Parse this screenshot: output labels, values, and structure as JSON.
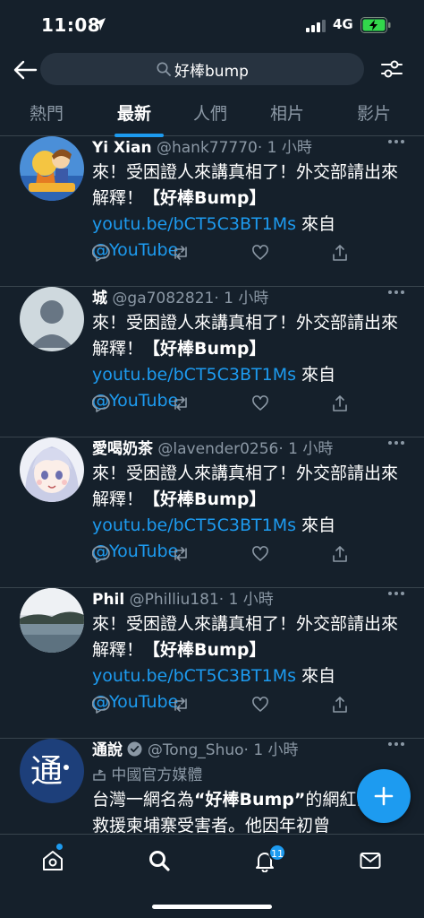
{
  "status_bar": {
    "time": "11:08",
    "network": "4G",
    "colors": {
      "battery": "#32d74b"
    }
  },
  "search": {
    "query": "好棒bump"
  },
  "tabs": [
    {
      "label": "熱門"
    },
    {
      "label": "最新",
      "active": true
    },
    {
      "label": "人們"
    },
    {
      "label": "相片"
    },
    {
      "label": "影片"
    }
  ],
  "tweets": [
    {
      "name": "Yi Xian",
      "handle": "@hank77770",
      "time": "· 1 小時",
      "text_a": "來！受困證人來講真相了！外交部請出來解釋！",
      "text_bold": "【好棒Bump】",
      "link": "youtu.be/bCT5C3BT1Ms",
      "via": " 來自 ",
      "mention": "@YouTube"
    },
    {
      "name": "城",
      "handle": "@ga7082821",
      "time": "· 1 小時",
      "text_a": "來！受困證人來講真相了！外交部請出來解釋！",
      "text_bold": "【好棒Bump】",
      "link": "youtu.be/bCT5C3BT1Ms",
      "via": " 來自 ",
      "mention": "@YouTube"
    },
    {
      "name": "愛喝奶茶",
      "handle": "@lavender0256",
      "time": "· 1 小時",
      "text_a": "來！受困證人來講真相了！外交部請出來解釋！",
      "text_bold": "【好棒Bump】",
      "link": "youtu.be/bCT5C3BT1Ms",
      "via": " 來自 ",
      "mention": "@YouTube"
    },
    {
      "name": "Phil",
      "handle": "@Philliu181",
      "time": "· 1 小時",
      "text_a": "來！受困證人來講真相了！外交部請出來解釋！",
      "text_bold": "【好棒Bump】",
      "link": "youtu.be/bCT5C3BT1Ms",
      "via": " 來自 ",
      "mention": "@YouTube"
    },
    {
      "name": "通說",
      "handle": "@Tong_Shuo",
      "time": "· 1 小時",
      "label": "中國官方媒體",
      "text_pre": "台灣一網名為",
      "text_quote": "“好棒Bump”",
      "text_post": "的網紅出力救援柬埔寨受害者。他因年初曾"
    }
  ],
  "avatar_glyph": "通",
  "notifications_badge": "11",
  "icons": {
    "back": "arrow-left-icon",
    "search": "search-icon",
    "filter": "sliders-icon",
    "reply": "reply-icon",
    "retweet": "retweet-icon",
    "like": "heart-icon",
    "share": "share-icon",
    "home": "home-icon",
    "explore": "search-icon",
    "notifications": "bell-icon",
    "messages": "mail-icon",
    "compose": "plus-icon",
    "verified": "verified-badge-icon"
  }
}
